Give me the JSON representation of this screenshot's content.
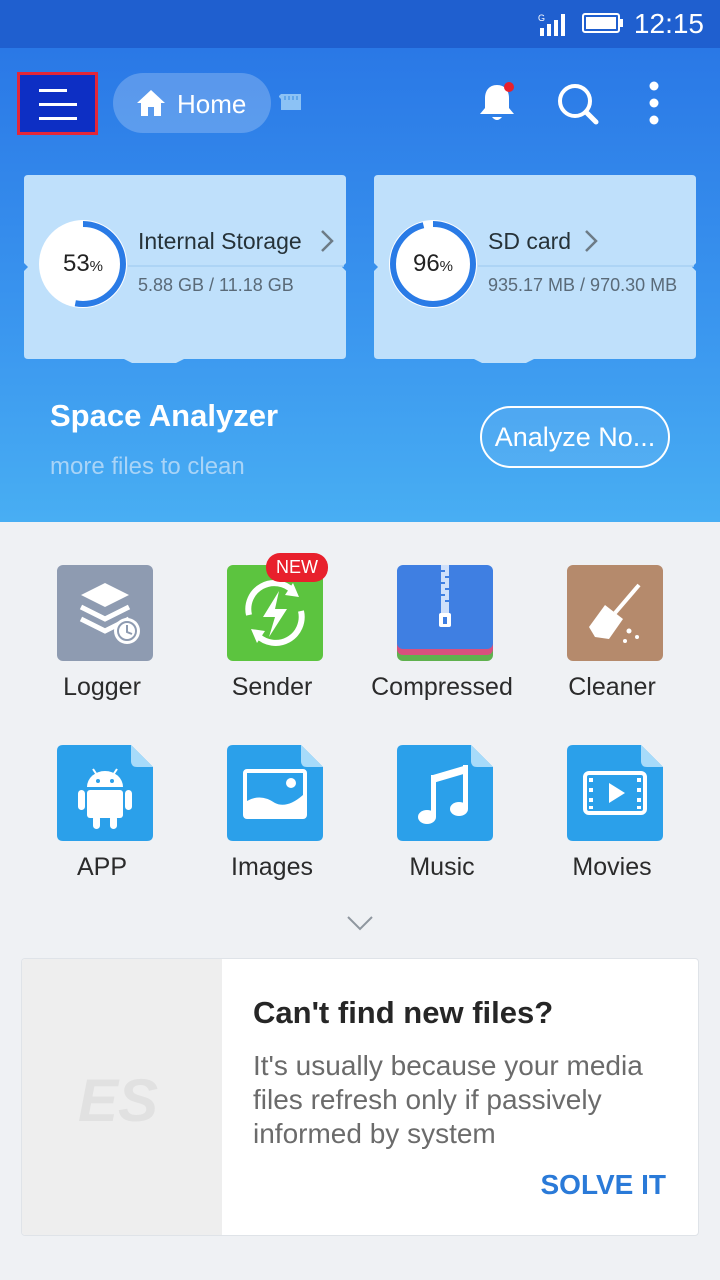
{
  "status_bar": {
    "time": "12:15",
    "network": "G"
  },
  "toolbar": {
    "home_label": "Home"
  },
  "storage": [
    {
      "name": "Internal Storage",
      "percent": "53",
      "percent_sign": "%",
      "usage": "5.88 GB / 11.18 GB",
      "fill_fraction": 0.53
    },
    {
      "name": "SD card",
      "percent": "96",
      "percent_sign": "%",
      "usage": "935.17 MB / 970.30 MB",
      "fill_fraction": 0.96
    }
  ],
  "space_analyzer": {
    "title": "Space Analyzer",
    "subtitle": "more files to clean",
    "button": "Analyze No..."
  },
  "categories": [
    {
      "label": "Logger",
      "icon": "logger-icon"
    },
    {
      "label": "Sender",
      "icon": "sender-icon",
      "badge": "NEW"
    },
    {
      "label": "Compressed",
      "icon": "compressed-icon"
    },
    {
      "label": "Cleaner",
      "icon": "cleaner-icon"
    },
    {
      "label": "APP",
      "icon": "android-icon"
    },
    {
      "label": "Images",
      "icon": "image-icon"
    },
    {
      "label": "Music",
      "icon": "music-note-icon"
    },
    {
      "label": "Movies",
      "icon": "movie-icon"
    }
  ],
  "promo": {
    "title": "Can't find new files?",
    "body": "It's usually because your media files refresh only if passively informed by system",
    "action": "SOLVE IT",
    "logo_text": "ES"
  },
  "colors": {
    "accent": "#2a78e6",
    "action_blue": "#2a7ad8",
    "highlight_red": "#e32639",
    "badge_red": "#e8202c"
  }
}
